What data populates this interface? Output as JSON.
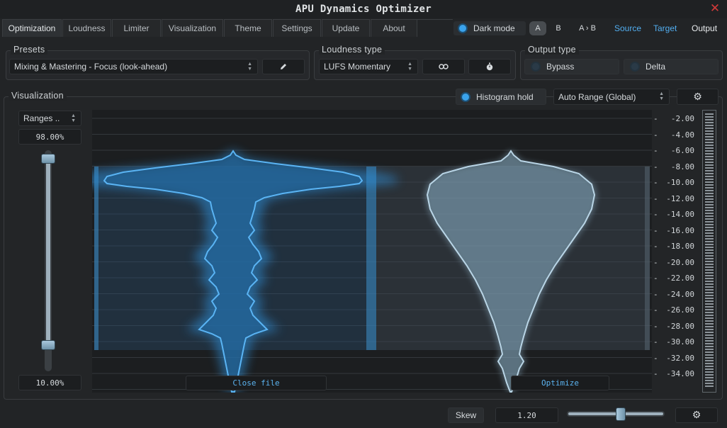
{
  "app": {
    "title": "APU Dynamics Optimizer"
  },
  "tabs": [
    {
      "label": "Optimization",
      "active": true
    },
    {
      "label": "Loudness"
    },
    {
      "label": "Limiter"
    },
    {
      "label": "Visualization"
    },
    {
      "label": "Theme"
    },
    {
      "label": "Settings"
    },
    {
      "label": "Update"
    },
    {
      "label": "About"
    }
  ],
  "header": {
    "dark_mode_label": "Dark mode",
    "ab": {
      "a": "A",
      "b": "B",
      "a_to_b": "A › B"
    },
    "sources": {
      "source": "Source",
      "target": "Target",
      "output": "Output"
    }
  },
  "presets": {
    "title": "Presets",
    "selected": "Mixing & Mastering - Focus (look-ahead)",
    "edit_icon": "pencil-icon"
  },
  "loudness_type": {
    "title": "Loudness type",
    "selected": "LUFS Momentary",
    "link_icon": "link-icon",
    "timer_icon": "stopwatch-icon"
  },
  "output_type": {
    "title": "Output type",
    "bypass_label": "Bypass",
    "delta_label": "Delta"
  },
  "visualization": {
    "title": "Visualization",
    "ranges_selected": "Ranges ..",
    "range_high": "98.00%",
    "range_low": "10.00%",
    "range_high_fraction": 0.98,
    "range_low_fraction": 0.1,
    "histogram_hold_label": "Histogram hold",
    "auto_range_selected": "Auto Range (Global)",
    "close_file_label": "Close file",
    "optimize_label": "Optimize",
    "y_ticks": [
      "-2.00",
      "-4.00",
      "-6.00",
      "-8.00",
      "-10.00",
      "-12.00",
      "-14.00",
      "-16.00",
      "-18.00",
      "-20.00",
      "-22.00",
      "-24.00",
      "-26.00",
      "-28.00",
      "-30.00",
      "-32.00",
      "-34.00"
    ]
  },
  "footer": {
    "skew_label": "Skew",
    "skew_value": "1.20",
    "skew_fraction": 0.5
  },
  "colors": {
    "accent": "#3aa3ec",
    "close": "#d43a3a",
    "source_histogram": "#3a9ee6",
    "target_histogram": "#9fc3da"
  }
}
